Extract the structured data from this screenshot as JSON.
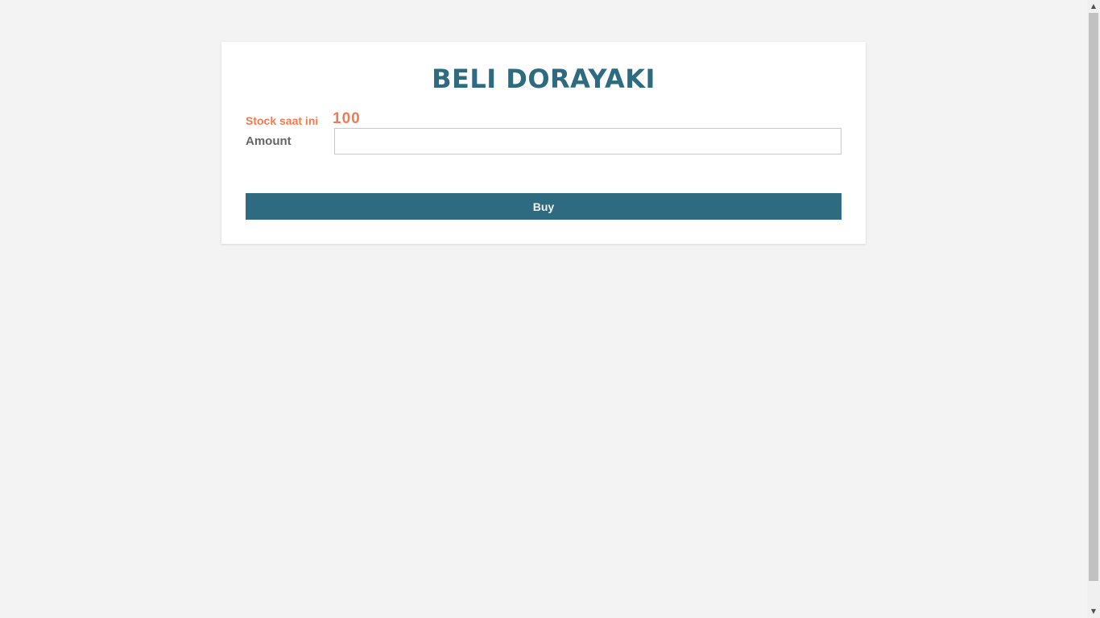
{
  "page": {
    "title": "BELI DORAYAKI"
  },
  "stock": {
    "label": "Stock saat ini",
    "value": "100"
  },
  "amount": {
    "label": "Amount",
    "value": "",
    "placeholder": ""
  },
  "actions": {
    "buy_label": "Buy"
  },
  "icons": {
    "scroll_up": "scroll-up-arrow-icon",
    "scroll_down": "scroll-down-arrow-icon"
  },
  "colors": {
    "accent": "#2e6a80",
    "stock": "#f27a50",
    "background": "#f3f3f3"
  }
}
